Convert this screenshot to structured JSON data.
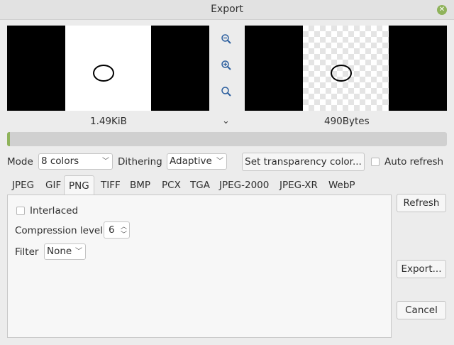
{
  "window": {
    "title": "Export",
    "close_icon": "close-icon"
  },
  "preview": {
    "original_size": "1.49KiB",
    "result_size": "490Bytes"
  },
  "progress": {
    "value": 0.006,
    "color": "#8fb35b"
  },
  "options": {
    "mode_label": "Mode",
    "mode_value": "8 colors",
    "dithering_label": "Dithering",
    "dithering_value": "Adaptive",
    "transparency_button": "Set transparency color...",
    "auto_refresh_label": "Auto refresh",
    "auto_refresh_checked": false
  },
  "tabs": [
    {
      "label": "JPEG"
    },
    {
      "label": "GIF"
    },
    {
      "label": "PNG",
      "active": true
    },
    {
      "label": "TIFF"
    },
    {
      "label": "BMP"
    },
    {
      "label": "PCX"
    },
    {
      "label": "TGA"
    },
    {
      "label": "JPEG-2000"
    },
    {
      "label": "JPEG-XR"
    },
    {
      "label": "WebP"
    }
  ],
  "png": {
    "interlaced_label": "Interlaced",
    "interlaced_checked": false,
    "compression_label": "Compression level",
    "compression_value": "6",
    "filter_label": "Filter",
    "filter_value": "None"
  },
  "buttons": {
    "refresh": "Refresh",
    "export": "Export...",
    "cancel": "Cancel"
  }
}
